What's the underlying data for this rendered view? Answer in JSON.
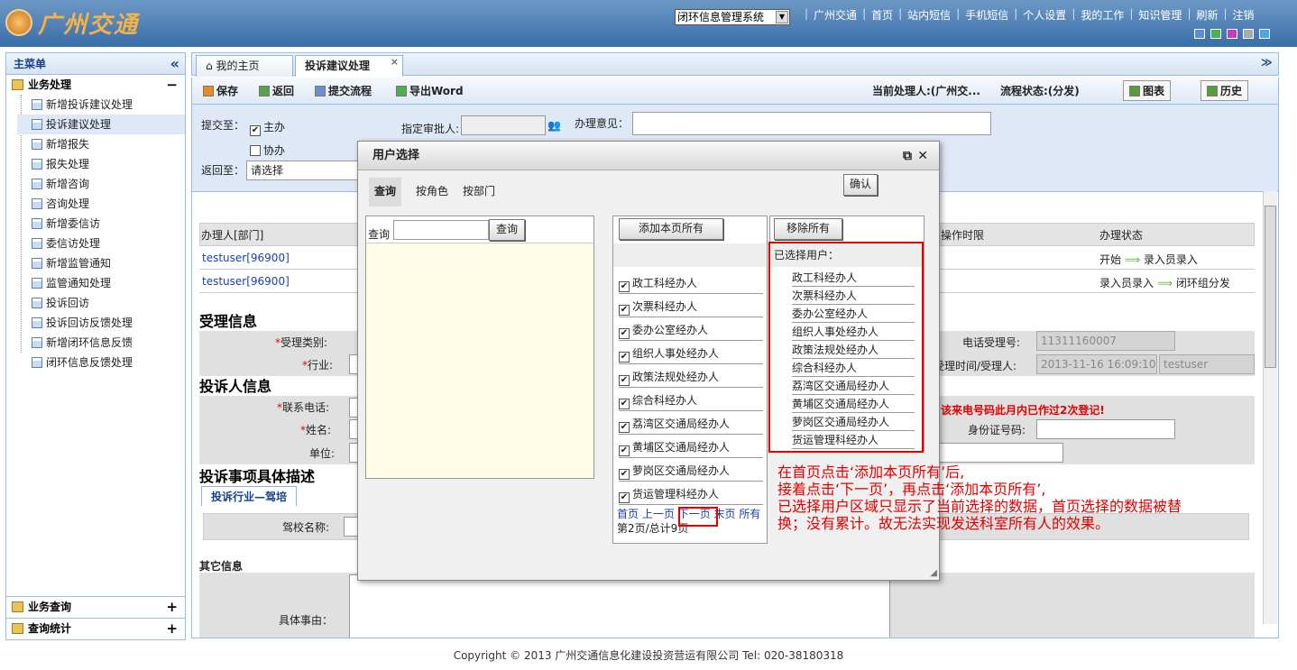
{
  "header": {
    "logo_text": "广州交通",
    "system_select": "闭环信息管理系统",
    "nav": [
      "广州交通",
      "首页",
      "站内短信",
      "手机短信",
      "个人设置",
      "我的工作",
      "知识管理",
      "刷新",
      "注销"
    ],
    "swatch_colors": [
      "#5a8fd8",
      "#4caf50",
      "#c040c0",
      "#aaaaaa",
      "#4aa8e0"
    ]
  },
  "sidebar": {
    "title": "主菜单",
    "collapse_icon": "«",
    "group_business": "业务处理",
    "items": [
      "新增投诉建议处理",
      "投诉建议处理",
      "新增报失",
      "报失处理",
      "新增咨询",
      "咨询处理",
      "新增委信访",
      "委信访处理",
      "新增监管通知",
      "监管通知处理",
      "投诉回访",
      "投诉回访反馈处理",
      "新增闭环信息反馈",
      "闭环信息反馈处理"
    ],
    "group_query": "业务查询",
    "group_stats": "查询统计",
    "plus": "+",
    "minus": "−"
  },
  "tabs": {
    "home": "我的主页",
    "complaint": "投诉建议处理",
    "close": "×",
    "menu": "≫"
  },
  "toolbar": {
    "save": "保存",
    "back": "返回",
    "submit": "提交流程",
    "export": "导出Word",
    "current_handler": "当前处理人:(广州交...",
    "flow_status": "流程状态:(分发)",
    "chart": "图表",
    "history": "历史"
  },
  "form": {
    "submit_to": "提交至：",
    "main": "主办",
    "assist": "协办",
    "return_to": "返回至：",
    "return_select": "请选择",
    "approver": "指定审批人:",
    "opinion": "办理意见："
  },
  "grid": {
    "col_handler": "办理人[部门]",
    "col_time_limit": "操作时限",
    "col_status": "办理状态",
    "rows": [
      {
        "handler": "testuser[96900]",
        "status_from": "开始",
        "status_to": "录入员录入"
      },
      {
        "handler": "testuser[96900]",
        "status_from": "录入员录入",
        "status_to": "闭环组分发"
      }
    ]
  },
  "sections": {
    "accept_info": "受理信息",
    "accept_type": "受理类别:",
    "industry": "行业:",
    "complainant_info": "投诉人信息",
    "phone": "联系电话:",
    "name": "姓名:",
    "unit": "单位:",
    "detail_desc": "投诉事项具体描述",
    "detail_tab": "投诉行业—驾培",
    "school_name": "驾校名称:",
    "other_info": "其它信息",
    "specific_reason": "具体事由：",
    "phone_accept_no": "电话受理号:",
    "phone_accept_no_value": "11311160007",
    "accept_time": "受理时间/受理人:",
    "accept_time_value": "2013-11-16 16:09:10",
    "accept_user": "testuser",
    "warning": "该来电号码此月内已作过2次登记!",
    "id_no": "身份证号码:"
  },
  "dialog": {
    "title": "用户选择",
    "tabs": [
      "查询",
      "按角色",
      "按部门"
    ],
    "confirm": "确认",
    "query_label": "查询",
    "query_button": "查询",
    "add_all": "添加本页所有",
    "remove_all": "移除所有",
    "selected_label": "已选择用户：",
    "list": [
      "政工科经办人",
      "次票科经办人",
      "委办公室经办人",
      "组织人事处经办人",
      "政策法规处经办人",
      "综合科经办人",
      "荔湾区交通局经办人",
      "黄埔区交通局经办人",
      "萝岗区交通局经办人",
      "货运管理科经办人"
    ],
    "selected": [
      "政工科经办人",
      "次票科经办人",
      "委办公室经办人",
      "组织人事处经办人",
      "政策法规处经办人",
      "综合科经办人",
      "荔湾区交通局经办人",
      "黄埔区交通局经办人",
      "萝岗区交通局经办人",
      "货运管理科经办人"
    ],
    "pager": {
      "first": "首页",
      "prev": "上一页",
      "next": "下一页",
      "last": "末页",
      "all": "所有",
      "info": "第2页/总计9页"
    }
  },
  "note": [
    "在首页点击‘添加本页所有’后,",
    "接着点击‘下一页’，再点击‘添加本页所有’,",
    "已选择用户区域只显示了当前选择的数据，首页选择的数据被替",
    "换；没有累计。故无法实现发送科室所有人的效果。"
  ],
  "footer": "Copyright © 2013 广州交通信息化建设投资营运有限公司  Tel: 020-38180318"
}
